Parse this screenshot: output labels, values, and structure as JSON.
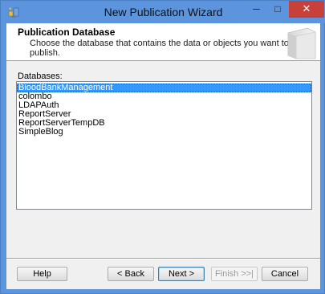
{
  "window": {
    "title": "New Publication Wizard",
    "controls": {
      "minimize": "─",
      "maximize": "□",
      "close": "✕"
    }
  },
  "header": {
    "title": "Publication Database",
    "description": "Choose the database that contains the data or objects you want to publish."
  },
  "databases": {
    "label": "Databases:",
    "items": [
      {
        "name": "BloodBankManagement",
        "selected": true
      },
      {
        "name": "colombo",
        "selected": false
      },
      {
        "name": "LDAPAuth",
        "selected": false
      },
      {
        "name": "ReportServer",
        "selected": false
      },
      {
        "name": "ReportServerTempDB",
        "selected": false
      },
      {
        "name": "SimpleBlog",
        "selected": false
      }
    ]
  },
  "buttons": {
    "help": "Help",
    "back": "< Back",
    "next": "Next >",
    "finish": "Finish >>|",
    "cancel": "Cancel"
  },
  "icons": {
    "app": "wizard-app-icon",
    "header": "publication-graphic-icon"
  }
}
